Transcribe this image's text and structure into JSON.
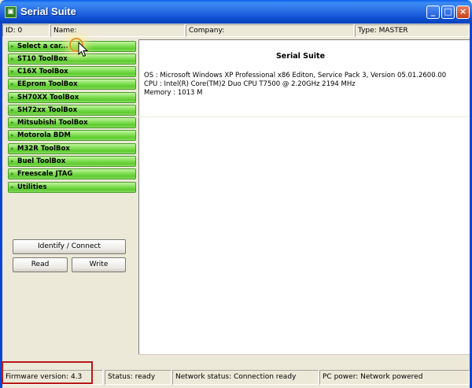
{
  "window": {
    "title": "Serial Suite",
    "minimize_glyph": "_",
    "maximize_glyph": "□",
    "close_glyph": "×"
  },
  "infobar": {
    "id": "ID: 0",
    "name": "Name:",
    "company": "Company:",
    "type": "Type: MASTER"
  },
  "toolboxes": [
    {
      "label": "Select a car..."
    },
    {
      "label": "ST10 ToolBox"
    },
    {
      "label": "C16X ToolBox"
    },
    {
      "label": "EEprom ToolBox"
    },
    {
      "label": "SH70XX ToolBox"
    },
    {
      "label": "SH72xx ToolBox"
    },
    {
      "label": "Mitsubishi ToolBox"
    },
    {
      "label": "Motorola BDM"
    },
    {
      "label": "M32R ToolBox"
    },
    {
      "label": "Buel ToolBox"
    },
    {
      "label": "Freescale JTAG"
    },
    {
      "label": "Utilities"
    }
  ],
  "buttons": {
    "identify": "Identify / Connect",
    "read": "Read",
    "write": "Write"
  },
  "info": {
    "title": "Serial Suite",
    "os": "OS : Microsoft Windows XP Professional x86 Editon, Service Pack 3, Version 05.01.2600.00",
    "cpu": "CPU : Intel(R) Core(TM)2 Duo CPU      T7500  @ 2.20GHz 2194 MHz",
    "memory": "Memory : 1013 M"
  },
  "statusbar": {
    "firmware": "Firmware version: 4.3",
    "status": "Status: ready",
    "network": "Network status: Connection ready",
    "pc_power": "PC power: Network powered"
  },
  "colors": {
    "titlebar": "#2A6FE6",
    "toolbox_green": "#5CCB2C",
    "highlight_box": "#B81818"
  }
}
